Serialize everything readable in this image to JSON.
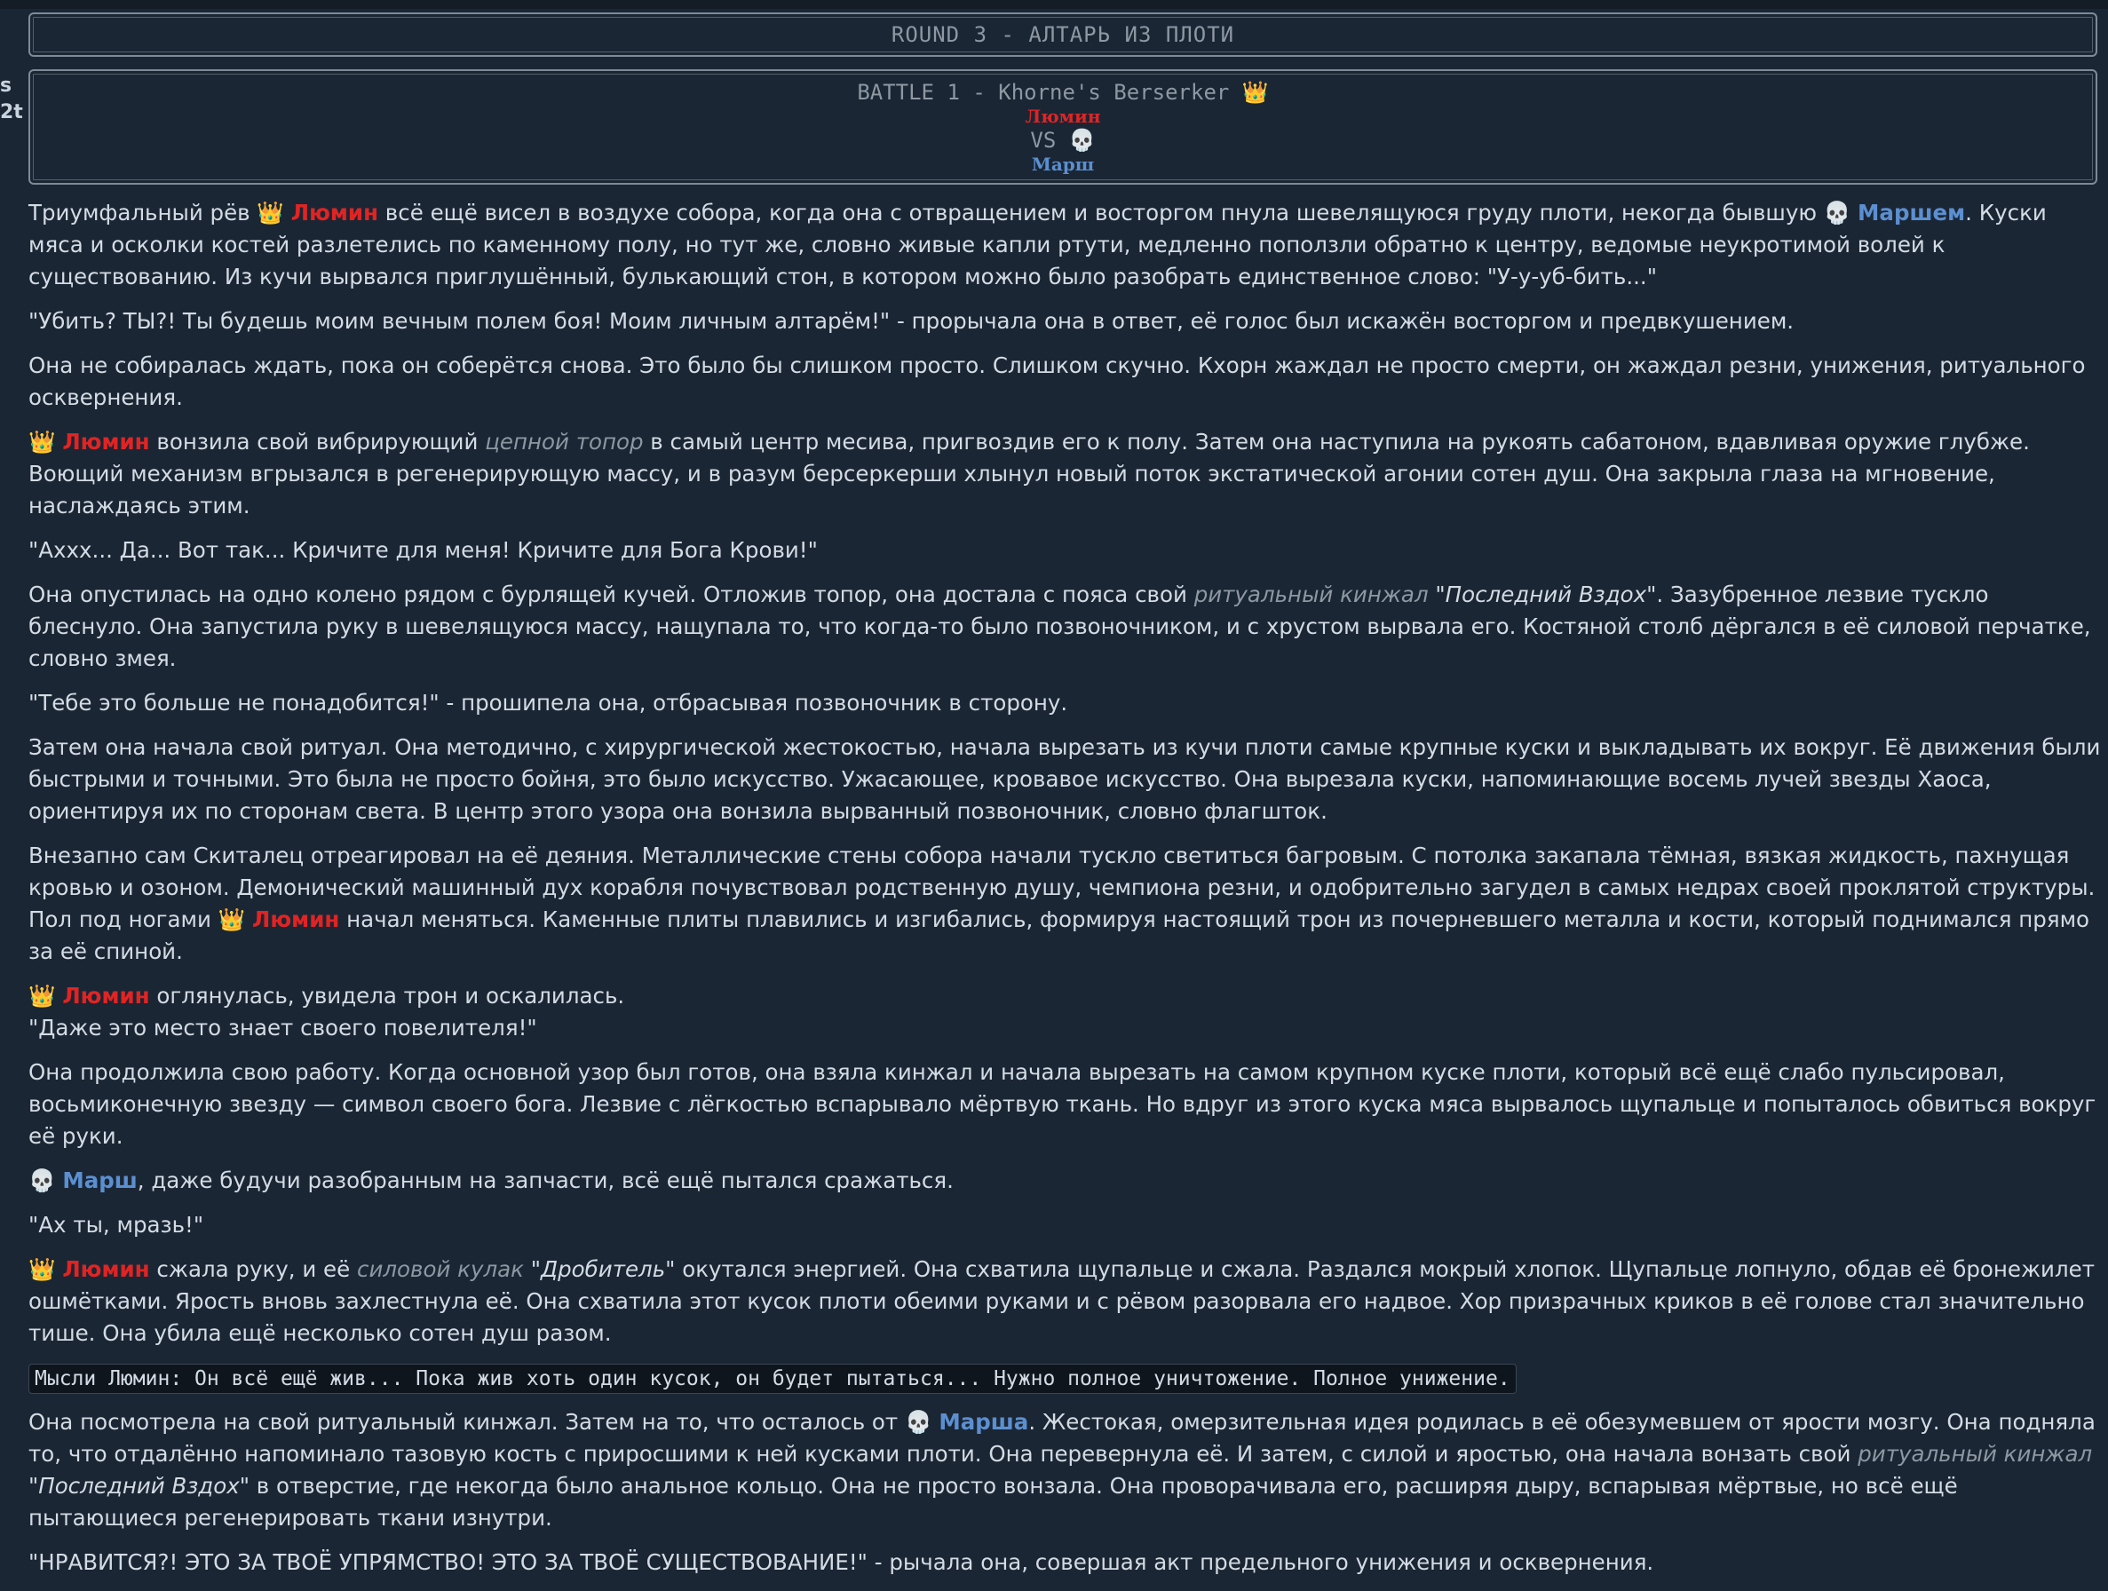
{
  "sidebar": {
    "glyph_lines": [
      "s",
      "2t"
    ]
  },
  "round": {
    "title": "ROUND 3 - АЛТАРЬ ИЗ ПЛОТИ"
  },
  "battle": {
    "title": "BATTLE 1 - Khorne's Berserker",
    "winner_icon": "crown-icon",
    "player1": "Люмин",
    "vs": "VS",
    "loser_icon": "skull-icon",
    "player2": "Марш"
  },
  "story": {
    "p1": {
      "a": "Триумфальный рёв ",
      "b": "Люмин",
      "c": " всё ещё висел в воздухе собора, когда она с отвращением и восторгом пнула шевелящуюся груду плоти, некогда бывшую ",
      "d": "Маршем",
      "e": ". Куски мяса и осколки костей разлетелись по каменному полу, но тут же, словно живые капли ртути, медленно поползли обратно к центру, ведомые неукротимой волей к существованию. Из кучи вырвался приглушённый, булькающий стон, в котором можно было разобрать единственное слово: \"У-у-уб-бить...\""
    },
    "p2": "\"Убить? ТЫ?! Ты будешь моим вечным полем боя! Моим личным алтарём!\" - прорычала она в ответ, её голос был искажён восторгом и предвкушением.",
    "p3": "Она не собиралась ждать, пока он соберётся снова. Это было бы слишком просто. Слишком скучно. Кхорн жаждал не просто смерти, он жаждал резни, унижения, ритуального осквернения.",
    "p4": {
      "name": "Люмин",
      "a": " вонзила свой вибрирующий ",
      "item": "цепной топор",
      "b": " в самый центр месива, пригвоздив его к полу. Затем она наступила на рукоять сабатоном, вдавливая оружие глубже. Воющий механизм вгрызался в регенерирующую массу, и в разум берсеркерши хлынул новый поток экстатической агонии сотен душ. Она закрыла глаза на мгновение, наслаждаясь этим."
    },
    "p5": "\"Ахxx... Да... Вот так... Кричите для меня! Кричите для Бога Крови!\"",
    "p6": {
      "a": "Она опустилась на одно колено рядом с бурлящей кучей. Отложив топор, она достала с пояса свой ",
      "item": "ритуальный кинжал",
      "iname": " \"Последний Вздох\"",
      "b": ". Зазубренное лезвие тускло блеснуло. Она запустила руку в шевелящуюся массу, нащупала то, что когда-то было позвоночником, и с хрустом вырвала его. Костяной столб дёргался в её силовой перчатке, словно змея."
    },
    "p7": "\"Тебе это больше не понадобится!\" - прошипела она, отбрасывая позвоночник в сторону.",
    "p8": "Затем она начала свой ритуал. Она методично, с хирургической жестокостью, начала вырезать из кучи плоти самые крупные куски и выкладывать их вокруг. Её движения были быстрыми и точными. Это была не просто бойня, это было искусство. Ужасающее, кровавое искусство. Она вырезала куски, напоминающие восемь лучей звезды Хаоса, ориентируя их по сторонам света. В центр этого узора она вонзила вырванный позвоночник, словно флагшток.",
    "p9": {
      "a": "Внезапно сам Скиталец отреагировал на её деяния. Металлические стены собора начали тускло светиться багровым. С потолка закапала тёмная, вязкая жидкость, пахнущая кровью и озоном. Демонический машинный дух корабля почувствовал родственную душу, чемпиона резни, и одобрительно загудел в самых недрах своей проклятой структуры. Пол под ногами ",
      "name": "Люмин",
      "b": " начал меняться. Каменные плиты плавились и изгибались, формируя настоящий трон из почерневшего металла и кости, который поднимался прямо за её спиной."
    },
    "p10": {
      "name": "Люмин",
      "a": " оглянулась, увидела трон и оскалилась.",
      "b": "\"Даже это место знает своего повелителя!\""
    },
    "p11": "Она продолжила свою работу. Когда основной узор был готов, она взяла кинжал и начала вырезать на самом крупном куске плоти, который всё ещё слабо пульсировал, восьмиконечную звезду — символ своего бога. Лезвие с лёгкостью вспарывало мёртвую ткань. Но вдруг из этого куска мяса вырвалось щупальце и попыталось обвиться вокруг её руки.",
    "p12": {
      "name": "Марш",
      "a": ", даже будучи разобранным на запчасти, всё ещё пытался сражаться."
    },
    "p13": "\"Ах ты, мразь!\"",
    "p14": {
      "name": "Люмин",
      "a": " сжала руку, и её ",
      "item": "силовой кулак",
      "iname": " \"Дробитель\"",
      "b": " окутался энергией. Она схватила щупальце и сжала. Раздался мокрый хлопок. Щупальце лопнуло, обдав её бронежилет ошмётками. Ярость вновь захлестнула её. Она схватила этот кусок плоти обеими руками и с рёвом разорвала его надвое. Хор призрачных криков в её голове стал значительно тише. Она убила ещё несколько сотен душ разом."
    },
    "thought": "Мысли Люмин: Он всё ещё жив... Пока жив хоть один кусок, он будет пытаться... Нужно полное уничтожение. Полное унижение.",
    "p15": {
      "a": "Она посмотрела на свой ритуальный кинжал. Затем на то, что осталось от ",
      "name": "Марша",
      "b": ". Жестокая, омерзительная идея родилась в её обезумевшем от ярости мозгу. Она подняла то, что отдалённо напоминало тазовую кость с приросшими к ней кусками плоти. Она перевернула её. И затем, с силой и яростью, она начала вонзать свой ",
      "item": "ритуальный кинжал",
      "iname": "\"Последний Вздох\"",
      "c": " в отверстие, где некогда было анальное кольцо. Она не просто вонзала. Она проворачивала его, расширяя дыру, вспарывая мёртвые, но всё ещё пытающиеся регенерировать ткани изнутри."
    },
    "p16": "\"НРАВИТСЯ?! ЭТО ЗА ТВОЁ УПРЯМСТВО! ЭТО ЗА ТВОЁ СУЩЕСТВОВАНИЕ!\" - рычала она, совершая акт предельного унижения и осквернения."
  },
  "colors": {
    "winner": "#e02424",
    "loser": "#5b8fd0",
    "background": "#1b2634",
    "text": "#d3dbe4",
    "muted": "#8d98a3"
  }
}
